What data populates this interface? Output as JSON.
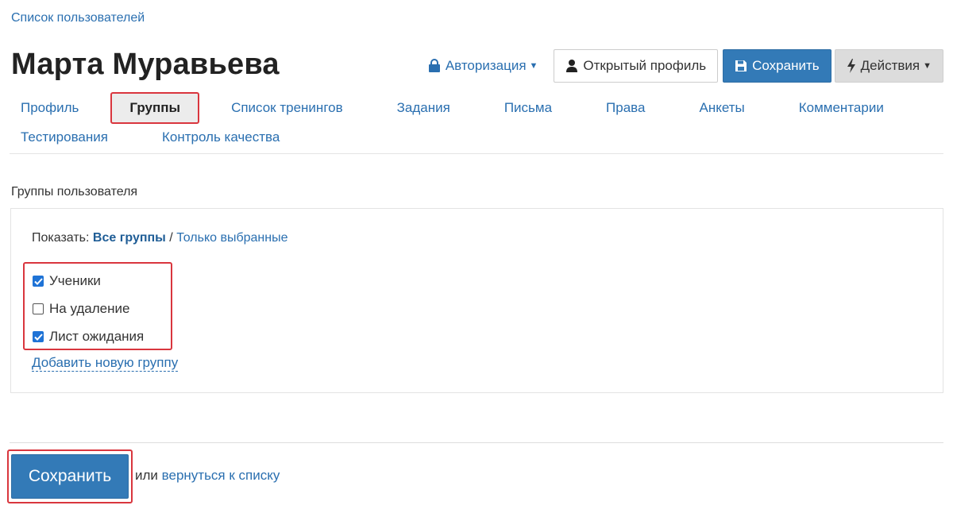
{
  "breadcrumb": "Список пользователей",
  "title": "Марта Муравьева",
  "header": {
    "auth_label": "Авторизация",
    "open_profile_label": "Открытый профиль",
    "save_label": "Сохранить",
    "actions_label": "Действия"
  },
  "tabs_row1": [
    "Профиль",
    "Группы",
    "Список тренингов",
    "Задания",
    "Письма",
    "Права",
    "Анкеты",
    "Комментарии"
  ],
  "tabs_row2": [
    "Тестирования",
    "Контроль качества"
  ],
  "active_tab": "Группы",
  "groups_section": {
    "label": "Группы пользователя",
    "filter_prefix": "Показать:",
    "filter_all": "Все группы",
    "filter_separator": "/",
    "filter_selected": "Только выбранные",
    "groups": [
      {
        "label": "Ученики",
        "checked": true
      },
      {
        "label": "На удаление",
        "checked": false
      },
      {
        "label": "Лист ожидания",
        "checked": true
      }
    ],
    "add_group_label": "Добавить новую группу"
  },
  "footer": {
    "save_label": "Сохранить",
    "or_text": "или",
    "back_link": "вернуться к списку"
  },
  "colors": {
    "link": "#2a6fb0",
    "primary": "#337ab7",
    "highlight": "#d9363e",
    "checkbox": "#1f73d6"
  },
  "icons": {
    "auth": "lock-icon",
    "open_profile": "user-icon",
    "save": "floppy-disk-icon",
    "actions": "bolt-icon"
  }
}
